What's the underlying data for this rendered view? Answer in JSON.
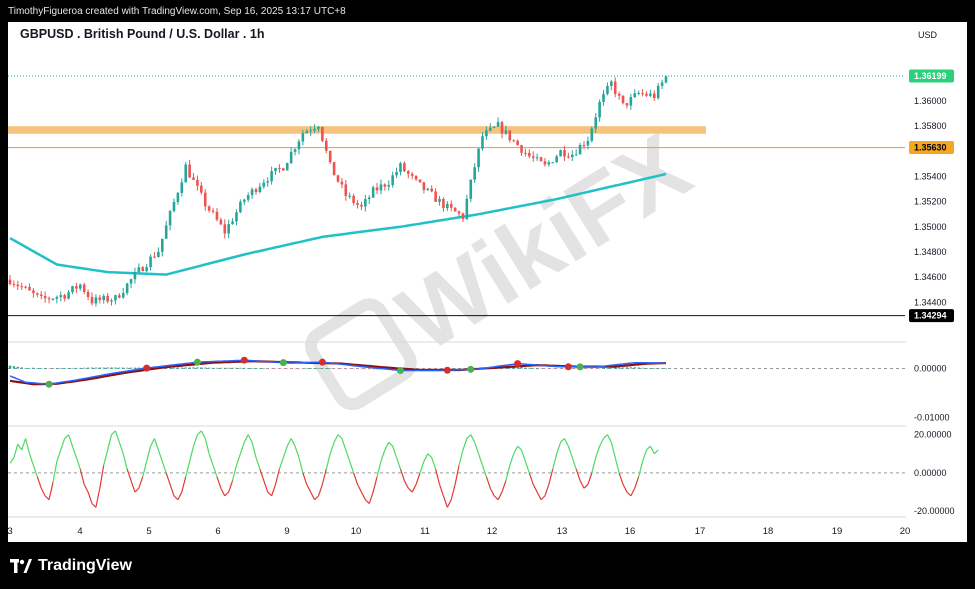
{
  "header": {
    "attribution": "TimothyFigueroa created with TradingView.com, Sep 16, 2025 13:17 UTC+8"
  },
  "footer": {
    "brand": "TradingView"
  },
  "watermark": {
    "text": "WikiFX"
  },
  "chart_data": {
    "type": "candlestick",
    "title": "GBPUSD . British Pound / U.S. Dollar . 1h",
    "currency_label": "USD",
    "colors": {
      "up": "#26a69a",
      "down": "#ef5350",
      "ma": "#1fc1c8",
      "zone": "#f7c27e",
      "last_price_tag": "#2bd07a",
      "level_tag": "#f5a623",
      "marker_tag": "#000000"
    },
    "price_axis": {
      "range": [
        1.3414,
        1.3631
      ],
      "ticks": [
        "1.36000",
        "1.35800",
        "1.35400",
        "1.35200",
        "1.35000",
        "1.34800",
        "1.34600",
        "1.34400"
      ]
    },
    "time_axis": {
      "labels": [
        "3",
        "4",
        "5",
        "6",
        "9",
        "10",
        "11",
        "12",
        "13",
        "16",
        "17",
        "18",
        "19",
        "20"
      ]
    },
    "price_labels": [
      {
        "value": "1.36199",
        "kind": "last_price"
      },
      {
        "value": "1.35630",
        "kind": "level"
      },
      {
        "value": "1.34294",
        "kind": "marker"
      }
    ],
    "levels": [
      {
        "price": 1.36199,
        "style": "dotted-green"
      },
      {
        "price": 1.3563,
        "style": "orange-line"
      },
      {
        "price": 1.34294,
        "style": "black-line"
      }
    ],
    "resistance_zone": {
      "low": 1.3574,
      "high": 1.358
    },
    "price_anchors": [
      [
        0,
        1.3458
      ],
      [
        8,
        1.3442
      ],
      [
        14,
        1.3446
      ],
      [
        18,
        1.3454
      ],
      [
        21,
        1.3441
      ],
      [
        27,
        1.3443
      ],
      [
        33,
        1.3465
      ],
      [
        38,
        1.3481
      ],
      [
        45,
        1.3548
      ],
      [
        50,
        1.3518
      ],
      [
        55,
        1.3496
      ],
      [
        60,
        1.3522
      ],
      [
        65,
        1.3537
      ],
      [
        70,
        1.3548
      ],
      [
        75,
        1.3575
      ],
      [
        79,
        1.3582
      ],
      [
        82,
        1.3548
      ],
      [
        86,
        1.3525
      ],
      [
        90,
        1.3515
      ],
      [
        93,
        1.3528
      ],
      [
        97,
        1.3536
      ],
      [
        100,
        1.3548
      ],
      [
        104,
        1.3535
      ],
      [
        108,
        1.3525
      ],
      [
        112,
        1.3515
      ],
      [
        116,
        1.3508
      ],
      [
        119,
        1.3548
      ],
      [
        121,
        1.3572
      ],
      [
        125,
        1.358
      ],
      [
        129,
        1.3568
      ],
      [
        133,
        1.3556
      ],
      [
        137,
        1.3548
      ],
      [
        141,
        1.356
      ],
      [
        144,
        1.3558
      ],
      [
        148,
        1.357
      ],
      [
        151,
        1.3598
      ],
      [
        154,
        1.3614
      ],
      [
        157,
        1.3596
      ],
      [
        161,
        1.3606
      ],
      [
        165,
        1.3604
      ],
      [
        168,
        1.3619
      ]
    ],
    "moving_average": [
      [
        0,
        1.3491
      ],
      [
        12,
        1.347
      ],
      [
        25,
        1.3464
      ],
      [
        40,
        1.3462
      ],
      [
        60,
        1.3478
      ],
      [
        80,
        1.3492
      ],
      [
        100,
        1.35
      ],
      [
        120,
        1.351
      ],
      [
        140,
        1.3522
      ],
      [
        168,
        1.3542
      ]
    ],
    "macd": {
      "ticks": [
        "0.00000",
        "-0.01000"
      ],
      "range": [
        -0.0115,
        0.005
      ],
      "macd_line": [
        [
          0,
          -0.0015
        ],
        [
          4,
          -0.0028
        ],
        [
          10,
          -0.0032
        ],
        [
          18,
          -0.0022
        ],
        [
          26,
          -0.001
        ],
        [
          36,
          0.0002
        ],
        [
          48,
          0.0013
        ],
        [
          60,
          0.0017
        ],
        [
          72,
          0.0011
        ],
        [
          80,
          0.0013
        ],
        [
          90,
          0.0004
        ],
        [
          100,
          -0.0004
        ],
        [
          110,
          -0.0004
        ],
        [
          120,
          -0.0001
        ],
        [
          130,
          0.001
        ],
        [
          140,
          0.0004
        ],
        [
          150,
          0.0003
        ],
        [
          160,
          0.0012
        ],
        [
          168,
          0.0011
        ]
      ],
      "signal_line": [
        [
          0,
          -0.0025
        ],
        [
          6,
          -0.0032
        ],
        [
          12,
          -0.0031
        ],
        [
          20,
          -0.0022
        ],
        [
          30,
          -0.0008
        ],
        [
          40,
          0.0003
        ],
        [
          52,
          0.0012
        ],
        [
          62,
          0.0015
        ],
        [
          75,
          0.0012
        ],
        [
          85,
          0.001
        ],
        [
          95,
          0.0003
        ],
        [
          105,
          -0.0003
        ],
        [
          115,
          -0.0003
        ],
        [
          125,
          0.0002
        ],
        [
          135,
          0.0007
        ],
        [
          145,
          0.0004
        ],
        [
          155,
          0.0004
        ],
        [
          163,
          0.001
        ],
        [
          168,
          0.0011
        ]
      ],
      "cross_markers": [
        [
          10,
          "up"
        ],
        [
          35,
          "down"
        ],
        [
          48,
          "up"
        ],
        [
          60,
          "down"
        ],
        [
          70,
          "up"
        ],
        [
          80,
          "down"
        ],
        [
          100,
          "up"
        ],
        [
          112,
          "down"
        ],
        [
          118,
          "up"
        ],
        [
          130,
          "down"
        ],
        [
          143,
          "down"
        ],
        [
          146,
          "up"
        ]
      ]
    },
    "oscillator": {
      "ticks": [
        "20.00000",
        "0.00000",
        "-20.00000"
      ],
      "range": [
        -22,
        24
      ],
      "samples": [
        5,
        8,
        15,
        12,
        18,
        10,
        4,
        -2,
        -8,
        -12,
        -14,
        -5,
        6,
        12,
        18,
        20,
        14,
        8,
        2,
        -6,
        -10,
        -16,
        -18,
        -8,
        4,
        12,
        20,
        22,
        16,
        10,
        2,
        -4,
        -10,
        -8,
        -2,
        6,
        14,
        18,
        12,
        6,
        0,
        -6,
        -12,
        -14,
        -10,
        -2,
        6,
        14,
        20,
        22,
        18,
        10,
        4,
        -2,
        -8,
        -12,
        -10,
        -4,
        4,
        10,
        16,
        20,
        16,
        8,
        2,
        -4,
        -10,
        -12,
        -6,
        2,
        8,
        14,
        18,
        14,
        8,
        0,
        -6,
        -10,
        -14,
        -12,
        -6,
        2,
        10,
        16,
        20,
        18,
        12,
        6,
        0,
        -6,
        -10,
        -14,
        -16,
        -10,
        -2,
        6,
        12,
        16,
        14,
        8,
        2,
        -4,
        -8,
        -10,
        -6,
        0,
        6,
        10,
        8,
        2,
        -6,
        -12,
        -18,
        -14,
        -6,
        4,
        12,
        18,
        20,
        16,
        10,
        4,
        -2,
        -8,
        -12,
        -14,
        -10,
        -4,
        4,
        10,
        14,
        12,
        6,
        0,
        -6,
        -10,
        -14,
        -12,
        -6,
        2,
        10,
        16,
        18,
        14,
        8,
        2,
        -4,
        -8,
        -6,
        0,
        8,
        14,
        18,
        20,
        16,
        8,
        0,
        -6,
        -10,
        -12,
        -8,
        -2,
        6,
        12,
        14,
        10,
        12
      ]
    }
  }
}
